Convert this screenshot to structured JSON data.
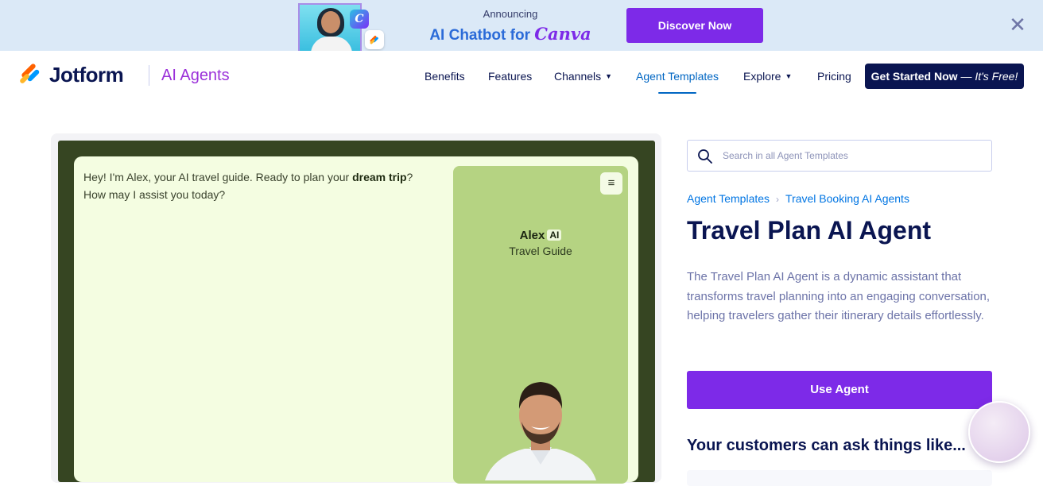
{
  "banner": {
    "announcing": "Announcing",
    "headline": "AI Chatbot for",
    "brand": "Canva",
    "canva_badge": "C",
    "button": "Discover Now",
    "close": "✕"
  },
  "nav": {
    "logo": "Jotform",
    "product": "AI Agents",
    "links": {
      "benefits": "Benefits",
      "features": "Features",
      "channels": "Channels",
      "agent_templates": "Agent Templates",
      "explore": "Explore",
      "pricing": "Pricing"
    },
    "cta_main": "Get Started Now",
    "cta_free": "— It's Free!"
  },
  "preview": {
    "message_part1": "Hey! I'm Alex, your AI travel guide. Ready to plan your ",
    "message_bold": "dream trip",
    "message_part2": "? How may I assist you today?",
    "agent_name": "Alex",
    "ai_tag": "AI",
    "agent_role": "Travel Guide",
    "menu_icon": "≡"
  },
  "sidebar": {
    "search_placeholder": "Search in all Agent Templates",
    "breadcrumb": [
      "Agent Templates",
      "Travel Booking AI Agents"
    ],
    "breadcrumb_sep": "›",
    "title": "Travel Plan AI Agent",
    "description": "The Travel Plan AI Agent is a dynamic assistant that transforms travel planning into an engaging conversation, helping travelers gather their itinerary details effortlessly.",
    "use_button": "Use Agent",
    "ask_heading": "Your customers can ask things like..."
  },
  "colors": {
    "accent_purple": "#7d2ae8",
    "navy": "#0a1551",
    "link_blue": "#0075e3",
    "chat_dark_green": "#364522",
    "chat_light_green": "#b5d382"
  },
  "icons": [
    "search-icon",
    "close-icon",
    "menu-icon",
    "chevron-down-icon",
    "jotform-logo-icon"
  ]
}
